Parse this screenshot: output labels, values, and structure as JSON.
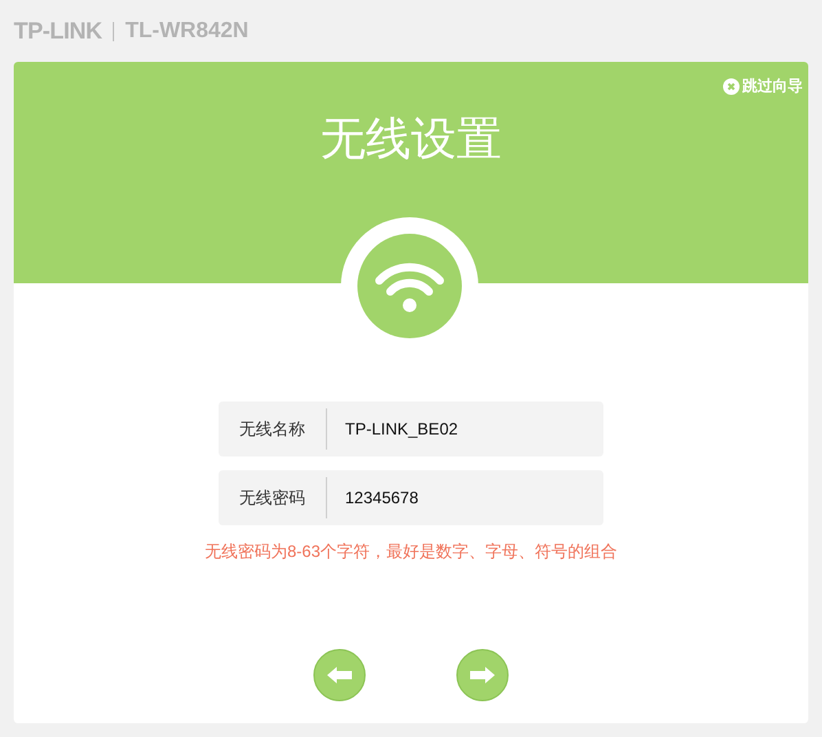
{
  "header": {
    "logo": "TP-LINK",
    "model": "TL-WR842N"
  },
  "banner": {
    "skip_link": "跳过向导",
    "title": "无线设置"
  },
  "fields": [
    {
      "label": "无线名称",
      "value": "TP-LINK_BE02"
    },
    {
      "label": "无线密码",
      "value": "12345678"
    }
  ],
  "hint": "无线密码为8-63个字符，最好是数字、字母、符号的组合"
}
